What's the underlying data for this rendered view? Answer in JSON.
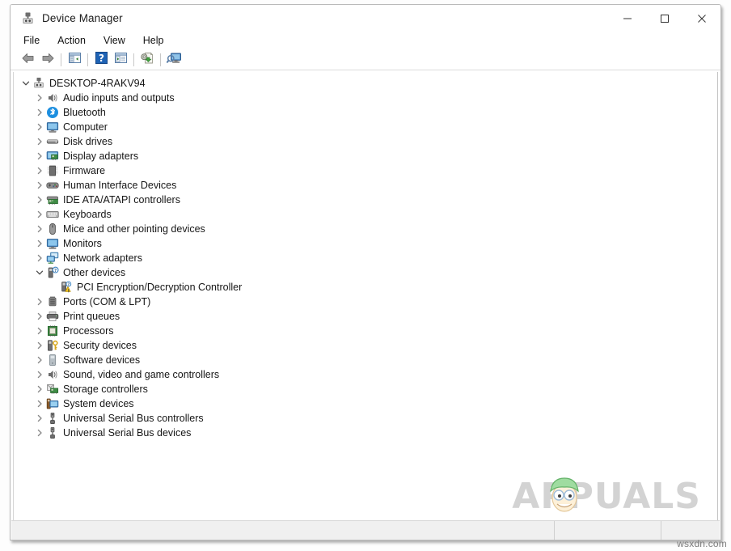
{
  "window": {
    "title": "Device Manager",
    "icon": "device-manager-icon",
    "controls": {
      "minimize": "—",
      "maximize": "☐",
      "close": "✕"
    }
  },
  "menubar": {
    "items": [
      {
        "label": "File",
        "name": "menu-file"
      },
      {
        "label": "Action",
        "name": "menu-action"
      },
      {
        "label": "View",
        "name": "menu-view"
      },
      {
        "label": "Help",
        "name": "menu-help"
      }
    ]
  },
  "toolbar": {
    "buttons": [
      {
        "name": "back-button",
        "icon": "back-arrow-icon",
        "tooltip": "Back"
      },
      {
        "name": "forward-button",
        "icon": "forward-arrow-icon",
        "tooltip": "Forward"
      },
      {
        "name": "show-hide-console-tree-button",
        "icon": "console-tree-icon",
        "tooltip": "Show/Hide Console Tree"
      },
      {
        "name": "help-button",
        "icon": "question-mark-icon",
        "tooltip": "Help"
      },
      {
        "name": "properties-button",
        "icon": "properties-icon",
        "tooltip": "Properties"
      },
      {
        "name": "update-driver-button",
        "icon": "update-driver-icon",
        "tooltip": "Update Driver Software"
      },
      {
        "name": "scan-hardware-changes-button",
        "icon": "scan-monitor-icon",
        "tooltip": "Scan for hardware changes"
      }
    ]
  },
  "tree": {
    "root": {
      "label": "DESKTOP-4RAKV94",
      "icon": "computer-root-icon",
      "expanded": true,
      "level": 0
    },
    "items": [
      {
        "label": "Audio inputs and outputs",
        "icon": "speaker-icon",
        "expanded": false,
        "level": 1,
        "warning": false
      },
      {
        "label": "Bluetooth",
        "icon": "bluetooth-icon",
        "expanded": false,
        "level": 1,
        "warning": false
      },
      {
        "label": "Computer",
        "icon": "monitor-icon",
        "expanded": false,
        "level": 1,
        "warning": false
      },
      {
        "label": "Disk drives",
        "icon": "disk-drive-icon",
        "expanded": false,
        "level": 1,
        "warning": false
      },
      {
        "label": "Display adapters",
        "icon": "display-adapter-icon",
        "expanded": false,
        "level": 1,
        "warning": false
      },
      {
        "label": "Firmware",
        "icon": "firmware-chip-icon",
        "expanded": false,
        "level": 1,
        "warning": false
      },
      {
        "label": "Human Interface Devices",
        "icon": "gamepad-icon",
        "expanded": false,
        "level": 1,
        "warning": false
      },
      {
        "label": "IDE ATA/ATAPI controllers",
        "icon": "ide-controller-icon",
        "expanded": false,
        "level": 1,
        "warning": false
      },
      {
        "label": "Keyboards",
        "icon": "keyboard-icon",
        "expanded": false,
        "level": 1,
        "warning": false
      },
      {
        "label": "Mice and other pointing devices",
        "icon": "mouse-icon",
        "expanded": false,
        "level": 1,
        "warning": false
      },
      {
        "label": "Monitors",
        "icon": "monitor-icon",
        "expanded": false,
        "level": 1,
        "warning": false
      },
      {
        "label": "Network adapters",
        "icon": "network-adapter-icon",
        "expanded": false,
        "level": 1,
        "warning": false
      },
      {
        "label": "Other devices",
        "icon": "other-device-icon",
        "expanded": true,
        "level": 1,
        "warning": false
      },
      {
        "label": "PCI Encryption/Decryption Controller",
        "icon": "unknown-device-icon",
        "expanded": null,
        "level": 2,
        "warning": true
      },
      {
        "label": "Ports (COM & LPT)",
        "icon": "port-icon",
        "expanded": false,
        "level": 1,
        "warning": false
      },
      {
        "label": "Print queues",
        "icon": "printer-icon",
        "expanded": false,
        "level": 1,
        "warning": false
      },
      {
        "label": "Processors",
        "icon": "processor-icon",
        "expanded": false,
        "level": 1,
        "warning": false
      },
      {
        "label": "Security devices",
        "icon": "security-key-icon",
        "expanded": false,
        "level": 1,
        "warning": false
      },
      {
        "label": "Software devices",
        "icon": "software-device-icon",
        "expanded": false,
        "level": 1,
        "warning": false
      },
      {
        "label": "Sound, video and game controllers",
        "icon": "speaker-icon",
        "expanded": false,
        "level": 1,
        "warning": false
      },
      {
        "label": "Storage controllers",
        "icon": "storage-controller-icon",
        "expanded": false,
        "level": 1,
        "warning": false
      },
      {
        "label": "System devices",
        "icon": "system-device-icon",
        "expanded": false,
        "level": 1,
        "warning": false
      },
      {
        "label": "Universal Serial Bus controllers",
        "icon": "usb-icon",
        "expanded": false,
        "level": 1,
        "warning": false
      },
      {
        "label": "Universal Serial Bus devices",
        "icon": "usb-icon",
        "expanded": false,
        "level": 1,
        "warning": false
      }
    ]
  },
  "statusbar": {
    "message": "",
    "pane_two": "",
    "pane_three": ""
  },
  "watermarks": {
    "brand": "APPUALS",
    "brand_color": "#d3d3d3",
    "site": "wsxdn.com"
  }
}
